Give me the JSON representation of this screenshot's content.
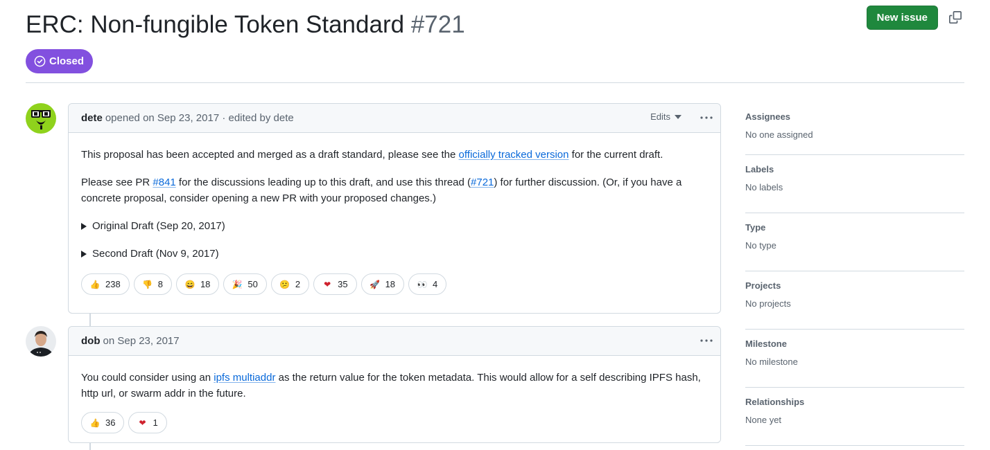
{
  "issue": {
    "title": "ERC: Non-fungible Token Standard",
    "number": "#721",
    "state": "Closed",
    "new_issue_label": "New issue"
  },
  "comments": [
    {
      "author": "dete",
      "meta": "opened on Sep 23, 2017 · edited by dete",
      "edits_label": "Edits",
      "body": {
        "p1_pre": "This proposal has been accepted and merged as a draft standard, please see the ",
        "p1_link": "officially tracked version",
        "p1_post": " for the current draft.",
        "p2_pre": "Please see PR ",
        "p2_link1": "#841",
        "p2_mid": " for the discussions leading up to this draft, and use this thread (",
        "p2_link2": "#721",
        "p2_post": ") for further discussion. (Or, if you have a concrete proposal, consider opening a new PR with your proposed changes.)",
        "details1": "Original Draft (Sep 20, 2017)",
        "details2": "Second Draft (Nov 9, 2017)"
      },
      "reactions": [
        {
          "icon": "thumbs-up-icon",
          "count": "238"
        },
        {
          "icon": "thumbs-down-icon",
          "count": "8"
        },
        {
          "icon": "laugh-icon",
          "count": "18"
        },
        {
          "icon": "hooray-icon",
          "count": "50"
        },
        {
          "icon": "confused-icon",
          "count": "2"
        },
        {
          "icon": "heart-icon",
          "count": "35"
        },
        {
          "icon": "rocket-icon",
          "count": "18"
        },
        {
          "icon": "eyes-icon",
          "count": "4"
        }
      ]
    },
    {
      "author": "dob",
      "meta": "on Sep 23, 2017",
      "body": {
        "p1_pre": "You could consider using an ",
        "p1_link": "ipfs multiaddr",
        "p1_post": " as the return value for the token metadata. This would allow for a self describing IPFS hash, http url, or swarm addr in the future."
      },
      "reactions": [
        {
          "icon": "thumbs-up-icon",
          "count": "36"
        },
        {
          "icon": "heart-icon",
          "count": "1"
        }
      ]
    }
  ],
  "sidebar": [
    {
      "heading": "Assignees",
      "value": "No one assigned"
    },
    {
      "heading": "Labels",
      "value": "No labels"
    },
    {
      "heading": "Type",
      "value": "No type"
    },
    {
      "heading": "Projects",
      "value": "No projects"
    },
    {
      "heading": "Milestone",
      "value": "No milestone"
    },
    {
      "heading": "Relationships",
      "value": "None yet"
    }
  ],
  "colors": {
    "closed": "#8250df",
    "primary_button": "#1f883d",
    "link": "#0969da"
  }
}
